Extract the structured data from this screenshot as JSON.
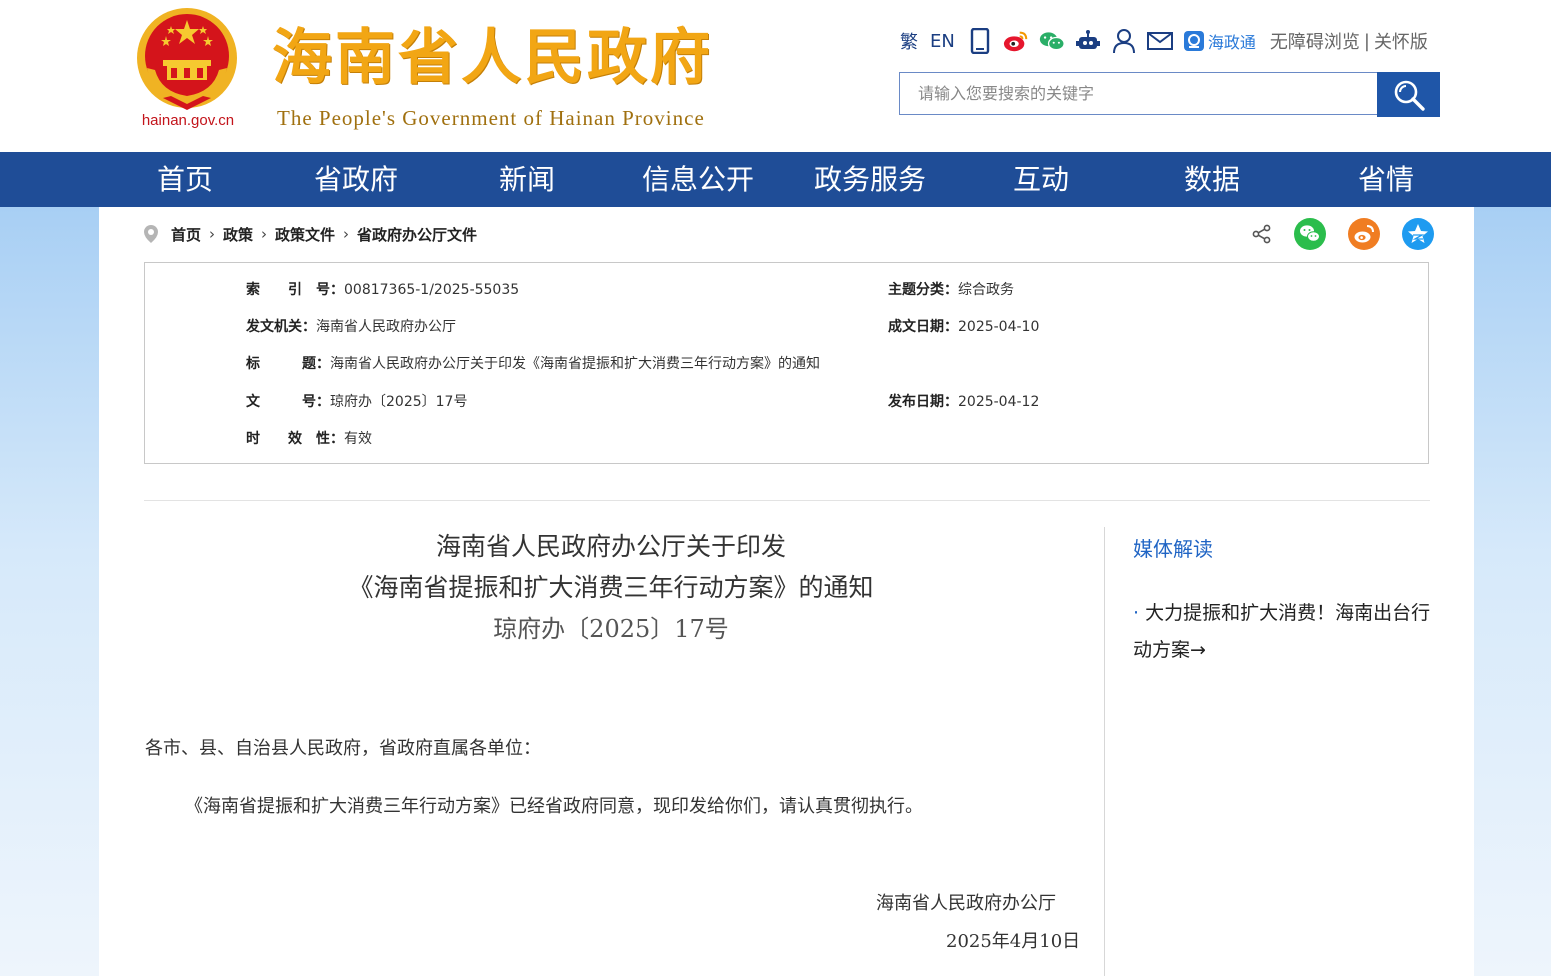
{
  "header": {
    "logo_url": "hainan.gov.cn",
    "logo_cn": "海南省人民政府",
    "logo_en": "The People's Government of Hainan Province",
    "tools": {
      "traditional": "繁",
      "english": "EN",
      "haizhengtong": "海政通",
      "accessible": "无障碍浏览",
      "separator": "|",
      "elderly": "关怀版"
    },
    "search": {
      "placeholder": "请输入您要搜索的关键字"
    }
  },
  "nav": {
    "items": [
      "首页",
      "省政府",
      "新闻",
      "信息公开",
      "政务服务",
      "互动",
      "数据",
      "省情"
    ]
  },
  "breadcrumb": {
    "items": [
      "首页",
      "政策",
      "政策文件",
      "省政府办公厅文件"
    ]
  },
  "meta": {
    "index_label": "索　　引　号：",
    "index_value": "00817365-1/2025-55035",
    "category_label": "主题分类：",
    "category_value": "综合政务",
    "issuer_label": "发文机关：",
    "issuer_value": "海南省人民政府办公厅",
    "date_made_label": "成文日期：",
    "date_made_value": "2025-04-10",
    "title_label": "标　　　题：",
    "title_value": "海南省人民政府办公厅关于印发《海南省提振和扩大消费三年行动方案》的通知",
    "docno_label": "文　　　号：",
    "docno_value": "琼府办〔2025〕17号",
    "pub_date_label": "发布日期：",
    "pub_date_value": "2025-04-12",
    "validity_label": "时　　效　性：",
    "validity_value": "有效"
  },
  "article": {
    "title_line1": "海南省人民政府办公厅关于印发",
    "title_line2": "《海南省提振和扩大消费三年行动方案》的通知",
    "doc_number": "琼府办〔2025〕17号",
    "salutation": "各市、县、自治县人民政府，省政府直属各单位：",
    "body": "《海南省提振和扩大消费三年行动方案》已经省政府同意，现印发给你们，请认真贯彻执行。",
    "signer": "海南省人民政府办公厅",
    "date": "2025年4月10日"
  },
  "sidebar": {
    "title": "媒体解读",
    "link_dot": "·",
    "link_text": "大力提振和扩大消费！海南出台行动方案→"
  },
  "colors": {
    "nav_bg": "#1f4d97",
    "logo_gold": "#f2a614",
    "link_blue": "#1f64c4",
    "emblem_red": "#c3141b"
  }
}
